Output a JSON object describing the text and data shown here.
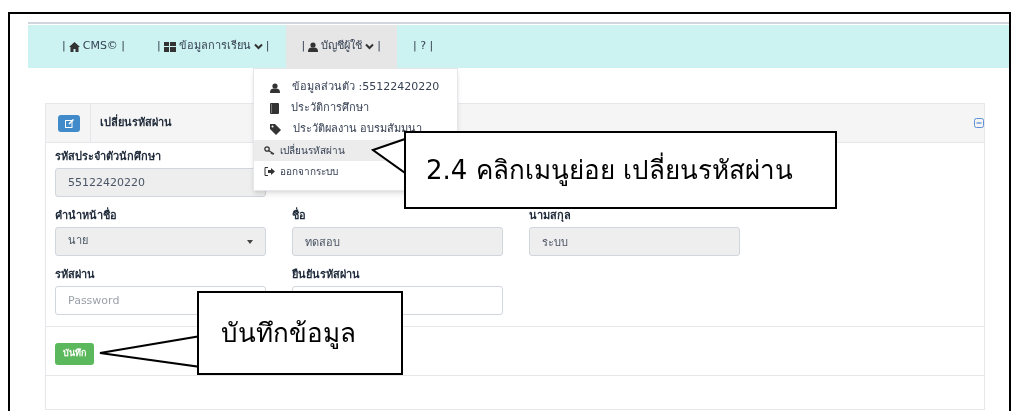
{
  "navbar": {
    "items": [
      {
        "prefix": "|",
        "label": "CMS©",
        "suffix": "|",
        "dropdown": false,
        "selected": false
      },
      {
        "prefix": "|",
        "label": "ข้อมูลการเรียน",
        "suffix": "|",
        "dropdown": true,
        "selected": false
      },
      {
        "prefix": "|",
        "label": "บัญชีผู้ใช้",
        "suffix": "|",
        "dropdown": true,
        "selected": true
      },
      {
        "prefix": "|",
        "label": "?",
        "suffix": "|",
        "dropdown": false,
        "selected": false
      }
    ]
  },
  "dropdown_menu": {
    "items": [
      {
        "label": "ข้อมูลส่วนตัว :55122420220",
        "selected": false
      },
      {
        "label": "ประวัติการศึกษา",
        "selected": false
      },
      {
        "label": "ประวัติผลงาน อบรมสัมมนา",
        "selected": false
      },
      {
        "label": "เปลี่ยนรหัสผ่าน",
        "selected": true
      },
      {
        "label": "ออกจากระบบ",
        "selected": false
      }
    ]
  },
  "panel": {
    "title": "เปลี่ยนรหัสผ่าน",
    "rows": [
      [
        {
          "label": "รหัสประจำตัวนักศึกษา",
          "kind": "text",
          "value": "55122420220",
          "disabled": true
        }
      ],
      [
        {
          "label": "คำนำหน้าชื่อ",
          "kind": "select",
          "value": "นาย",
          "disabled": true
        },
        {
          "label": "ชื่อ",
          "kind": "text",
          "value": "ทดสอบ",
          "disabled": true
        },
        {
          "label": "นามสกุล",
          "kind": "text",
          "value": "ระบบ",
          "disabled": true
        }
      ],
      [
        {
          "label": "รหัสผ่าน",
          "kind": "text",
          "placeholder": "Password",
          "disabled": false
        },
        {
          "label": "ยืนยันรหัสผ่าน",
          "kind": "text",
          "disabled": false
        }
      ]
    ],
    "save_button": "บันทึก"
  },
  "callouts": [
    {
      "text": "2.4 คลิกเมนูย่อย เปลี่ยนรหัสผ่าน"
    },
    {
      "text": "บันทึกข้อมูล"
    }
  ]
}
